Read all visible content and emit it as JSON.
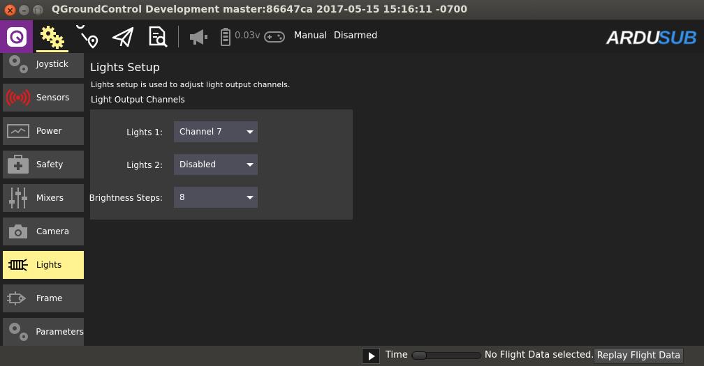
{
  "window": {
    "title": "QGroundControl Development master:86647ca 2017-05-15 15:16:11 -0700"
  },
  "toolbar": {
    "battery_voltage": "0.03v",
    "flight_mode": "Manual",
    "arm_state": "Disarmed",
    "brand_logo": "ARDUSUB"
  },
  "sidebar": {
    "items": [
      {
        "label": "Joystick",
        "icon": "gear-icon"
      },
      {
        "label": "Sensors",
        "icon": "radio-signal-icon"
      },
      {
        "label": "Power",
        "icon": "power-monitor-icon"
      },
      {
        "label": "Safety",
        "icon": "first-aid-kit-icon"
      },
      {
        "label": "Mixers",
        "icon": "sliders-icon"
      },
      {
        "label": "Camera",
        "icon": "camera-icon"
      },
      {
        "label": "Lights",
        "icon": "light-icon"
      },
      {
        "label": "Frame",
        "icon": "frame-icon"
      },
      {
        "label": "Parameters",
        "icon": "gears-icon"
      }
    ],
    "active": "Lights"
  },
  "main": {
    "title": "Lights Setup",
    "description": "Lights setup is used to adjust light output channels.",
    "section_title": "Light Output Channels",
    "rows": [
      {
        "label": "Lights 1:",
        "value": "Channel 7"
      },
      {
        "label": "Lights 2:",
        "value": "Disabled"
      },
      {
        "label": "Brightness Steps:",
        "value": "8"
      }
    ]
  },
  "bottombar": {
    "time_label": "Time",
    "status_text": "No Flight Data selected..",
    "replay_button": "Replay Flight Data"
  },
  "colors": {
    "accent": "#fff291",
    "brand_purple": "#7b2a8f",
    "combo_bg": "#4e4e5a"
  }
}
